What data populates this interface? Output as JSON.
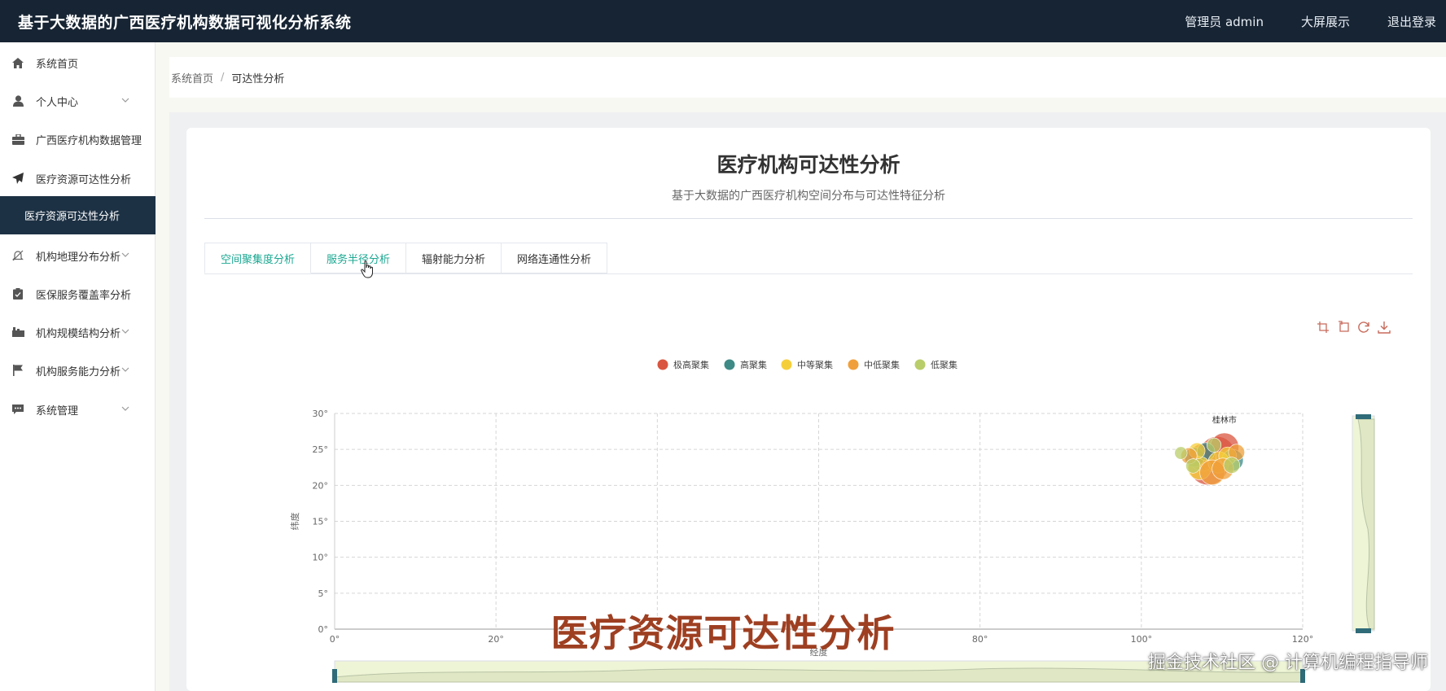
{
  "app": {
    "title": "基于大数据的广西医疗机构数据可视化分析系统",
    "user": "管理员 admin",
    "big_screen": "大屏展示",
    "logout": "退出登录"
  },
  "sidebar": {
    "items": [
      {
        "label": "系统首页",
        "icon": "home-icon"
      },
      {
        "label": "个人中心",
        "icon": "user-icon",
        "expandable": true
      },
      {
        "label": "广西医疗机构数据管理",
        "icon": "briefcase-icon"
      },
      {
        "label": "医疗资源可达性分析",
        "icon": "paper-plane-icon"
      },
      {
        "label": "机构地理分布分析",
        "icon": "bell-off-icon",
        "expandable": true
      },
      {
        "label": "医保服务覆盖率分析",
        "icon": "clipboard-icon"
      },
      {
        "label": "机构规模结构分析",
        "icon": "truck-icon",
        "expandable": true
      },
      {
        "label": "机构服务能力分析",
        "icon": "flag-icon",
        "expandable": true
      },
      {
        "label": "系统管理",
        "icon": "chat-icon",
        "expandable": true
      }
    ],
    "active_sub": "医疗资源可达性分析"
  },
  "breadcrumb": {
    "home": "系统首页",
    "current": "可达性分析"
  },
  "main": {
    "title": "医疗机构可达性分析",
    "subtitle": "基于大数据的广西医疗机构空间分布与可达性特征分析",
    "tabs": [
      {
        "label": "空间聚集度分析",
        "active": true
      },
      {
        "label": "服务半径分析",
        "hover": true
      },
      {
        "label": "辐射能力分析"
      },
      {
        "label": "网络连通性分析"
      }
    ]
  },
  "chart_data": {
    "type": "scatter",
    "legend": [
      {
        "name": "极高聚集",
        "color": "#d9553f"
      },
      {
        "name": "高聚集",
        "color": "#3e8a86"
      },
      {
        "name": "中等聚集",
        "color": "#f5cf3b"
      },
      {
        "name": "中低聚集",
        "color": "#f0a03a"
      },
      {
        "name": "低聚集",
        "color": "#b9cd6a"
      }
    ],
    "legend_position": "top-center",
    "xlabel": "经度",
    "ylabel": "纬度",
    "xlim": [
      0,
      120
    ],
    "ylim": [
      0,
      30
    ],
    "xticks": [
      "0°",
      "20°",
      "",
      "",
      "80°",
      "100°",
      "120°"
    ],
    "yticks": [
      "0°",
      "5°",
      "10°",
      "15°",
      "20°",
      "25°",
      "30°"
    ],
    "grid": true,
    "point_label": "桂林市",
    "series": [
      {
        "name": "极高聚集",
        "points": [
          [
            108.3,
            22.8,
            2.2
          ],
          [
            109.4,
            24.3,
            2.0
          ],
          [
            110.3,
            25.3,
            1.6
          ],
          [
            107.6,
            23.9,
            1.5
          ]
        ]
      },
      {
        "name": "高聚集",
        "points": [
          [
            106.6,
            23.9,
            1.1
          ],
          [
            111.3,
            23.5,
            1.2
          ],
          [
            108.0,
            24.7,
            1.0
          ]
        ]
      },
      {
        "name": "中等聚集",
        "points": [
          [
            107.2,
            22.4,
            1.3
          ],
          [
            109.6,
            23.2,
            1.2
          ],
          [
            110.7,
            24.1,
            1.0
          ],
          [
            106.9,
            24.8,
            0.9
          ]
        ]
      },
      {
        "name": "中低聚集",
        "points": [
          [
            108.8,
            21.8,
            1.4
          ],
          [
            110.1,
            22.3,
            1.2
          ],
          [
            105.9,
            24.1,
            0.9
          ],
          [
            111.8,
            24.6,
            0.9
          ]
        ]
      },
      {
        "name": "低聚集",
        "points": [
          [
            106.4,
            22.7,
            0.8
          ],
          [
            109.0,
            25.6,
            0.8
          ],
          [
            111.2,
            22.8,
            0.9
          ],
          [
            104.9,
            24.5,
            0.7
          ]
        ]
      }
    ]
  },
  "overlay": {
    "caption": "医疗资源可达性分析",
    "credit": "掘金技术社区 @ 计算机编程指导师"
  }
}
